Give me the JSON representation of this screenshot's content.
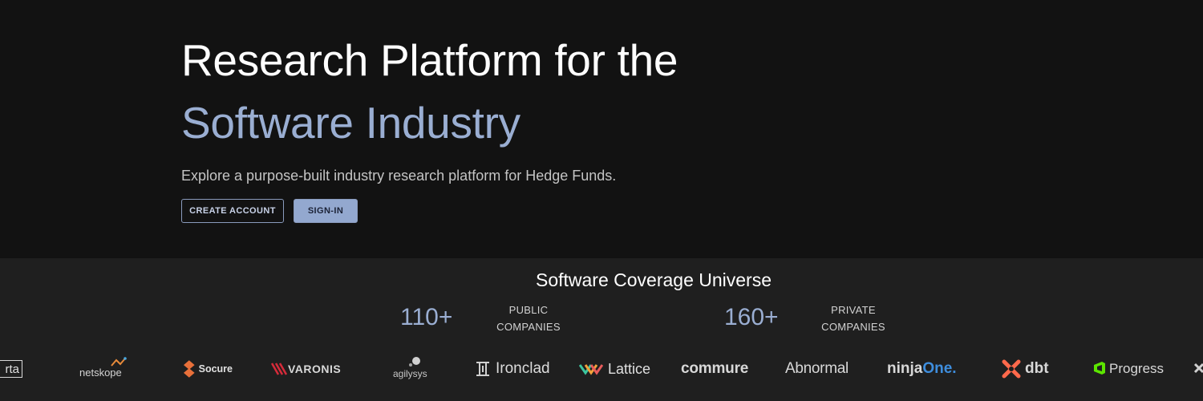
{
  "hero": {
    "title_strong": "Research Platform",
    "title_light": " for the",
    "title_accent": "Software Industry",
    "subtitle": "Explore a purpose-built industry research platform for Hedge Funds.",
    "create_account_label": "CREATE ACCOUNT",
    "sign_in_label": "SIGN-IN"
  },
  "coverage": {
    "title": "Software Coverage Universe",
    "public": {
      "count": "110+",
      "label_line1": "PUBLIC",
      "label_line2": "COMPANIES"
    },
    "private": {
      "count": "160+",
      "label_line1": "PRIVATE",
      "label_line2": "COMPANIES"
    }
  },
  "logos": [
    {
      "name": "rta",
      "text": "rta"
    },
    {
      "name": "netskope",
      "text": "netskope"
    },
    {
      "name": "socure",
      "text": "Socure"
    },
    {
      "name": "varonis",
      "text": "VARONIS"
    },
    {
      "name": "agilysys",
      "text": "agilysys"
    },
    {
      "name": "ironclad",
      "text": "Ironclad"
    },
    {
      "name": "lattice",
      "text": "Lattice"
    },
    {
      "name": "commure",
      "text": "commure"
    },
    {
      "name": "abnormal",
      "text": "Abnormal"
    },
    {
      "name": "ninjaone",
      "text_a": "ninja",
      "text_b": "One."
    },
    {
      "name": "dbt",
      "text": "dbt"
    },
    {
      "name": "progress",
      "text": "Progress"
    }
  ],
  "colors": {
    "hero_bg": "#121212",
    "coverage_bg": "#1f1f1f",
    "accent": "#9aaed2",
    "sign_in_bg": "#93a8cf",
    "socure_orange": "#e8703a",
    "varonis_red": "#d62b3a",
    "dbt_orange": "#ff694b",
    "progress_green": "#5ce500",
    "ninjaone_blue": "#3e8ede"
  }
}
